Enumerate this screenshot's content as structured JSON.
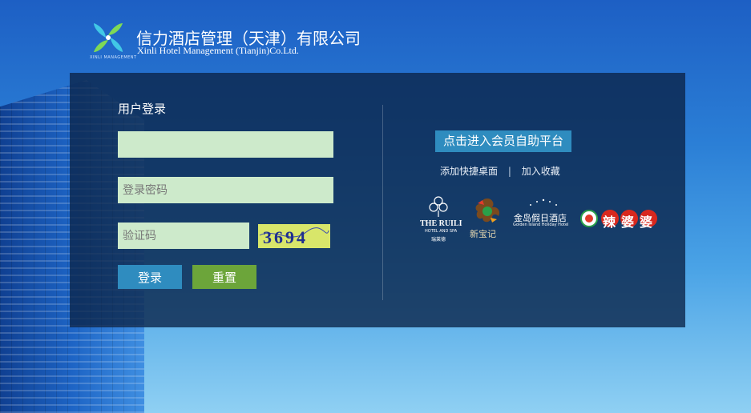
{
  "header": {
    "company_cn": "信力酒店管理（天津）有限公司",
    "company_en": "Xinli Hotel Management (Tianjin)Co.Ltd."
  },
  "login": {
    "title": "用户登录",
    "username": {
      "value": "",
      "placeholder": ""
    },
    "password": {
      "placeholder": "登录密码"
    },
    "captcha": {
      "placeholder": "验证码",
      "code": "3694"
    },
    "login_button": "登录",
    "reset_button": "重置"
  },
  "member": {
    "button": "点击进入会员自助平台",
    "add_shortcut": "添加快捷桌面",
    "separator": "|",
    "add_favorite": "加入收藏"
  },
  "brands": {
    "ruili_name": "THE RUILI",
    "ruili_sub": "HOTEL AND SPA",
    "ruili_cn": "瑞莱德",
    "xinbaoji": "新宝记",
    "golden_cn": "金岛假日酒店",
    "golden_en": "Golden Island Holiday Hotel",
    "lapopo": "辣婆婆"
  },
  "colors": {
    "accent_blue": "#2f8cbf",
    "reset_green": "#6ca53a",
    "field_bg": "#cdeacb",
    "captcha_bg": "#d8e66a"
  }
}
